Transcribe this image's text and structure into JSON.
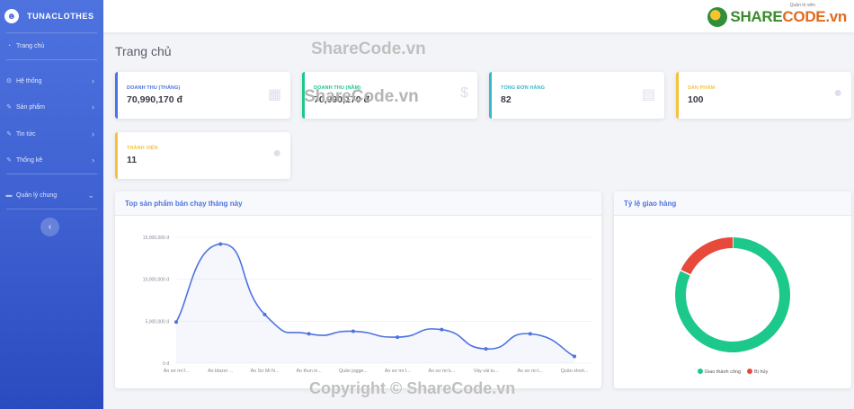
{
  "brand": {
    "name": "TUNACLOTHES",
    "icon": "smiley-logo-icon"
  },
  "sidebar": {
    "items": [
      {
        "label": "Trang chủ",
        "icon": "dashboard-icon",
        "chevron": ""
      },
      {
        "label": "Hệ thống",
        "icon": "gear-icon",
        "chevron": "›"
      },
      {
        "label": "Sản phẩm",
        "icon": "wrench-icon",
        "chevron": "›"
      },
      {
        "label": "Tin tức",
        "icon": "wrench-icon",
        "chevron": "›"
      },
      {
        "label": "Thống kê",
        "icon": "wrench-icon",
        "chevron": "›"
      },
      {
        "label": "Quản lý chung",
        "icon": "folder-icon",
        "chevron": "⌄"
      }
    ],
    "toggle": "‹"
  },
  "topbar": {
    "logo_a": "SHARE",
    "logo_b": "CODE.vn",
    "tagline": "Quản trị viên"
  },
  "page": {
    "title": "Trang chủ"
  },
  "stats": [
    {
      "label": "DOANH THU (THÁNG)",
      "value": "70,990,170 đ",
      "color": "#4e73df",
      "icon": "calendar-icon"
    },
    {
      "label": "DOANH THU (NĂM)",
      "value": "70,990,170 đ",
      "color": "#1cc88a",
      "icon": "dollar-icon"
    },
    {
      "label": "TỔNG ĐƠN HÀNG",
      "value": "82",
      "color": "#36b9cc",
      "icon": "clipboard-icon"
    },
    {
      "label": "SẢN PHẨM",
      "value": "100",
      "color": "#f6c23e",
      "icon": "user-icon"
    },
    {
      "label": "THÀNH VIÊN",
      "value": "11",
      "color": "#f6c23e",
      "icon": "user-icon"
    }
  ],
  "line_panel": {
    "title": "Top sản phẩm bán chạy tháng này"
  },
  "pie_panel": {
    "title": "Tỷ lệ giao hàng"
  },
  "watermarks": {
    "top": "ShareCode.vn",
    "bottom": "Copyright © ShareCode.vn"
  },
  "chart_data": [
    {
      "type": "area",
      "title": "Top sản phẩm bán chạy tháng này",
      "categories": [
        "Áo sơ mi f...",
        "Áo blazer ...",
        "Áo Sơ Mi N...",
        "Áo thun in...",
        "Quần jogge...",
        "Áo sơ mi f...",
        "Áo sơ mi k...",
        "Váy vải tu...",
        "Áo sơ mi t...",
        "Quần short..."
      ],
      "values": [
        4900000,
        14200000,
        5800000,
        3500000,
        3800000,
        3100000,
        4000000,
        1700000,
        3500000,
        800000
      ],
      "yticks": [
        "0 đ",
        "5,000,000 đ",
        "10,000,000 đ",
        "15,000,000 đ"
      ],
      "ylim": [
        0,
        15000000
      ],
      "grid": true,
      "color": "#4e73df"
    },
    {
      "type": "pie",
      "title": "Tỷ lệ giao hàng",
      "labels": [
        "Giao thành công",
        "Bị hủy"
      ],
      "values": [
        82,
        18
      ],
      "colors": [
        "#1cc88a",
        "#e74a3b"
      ],
      "legend": "bottom"
    }
  ]
}
